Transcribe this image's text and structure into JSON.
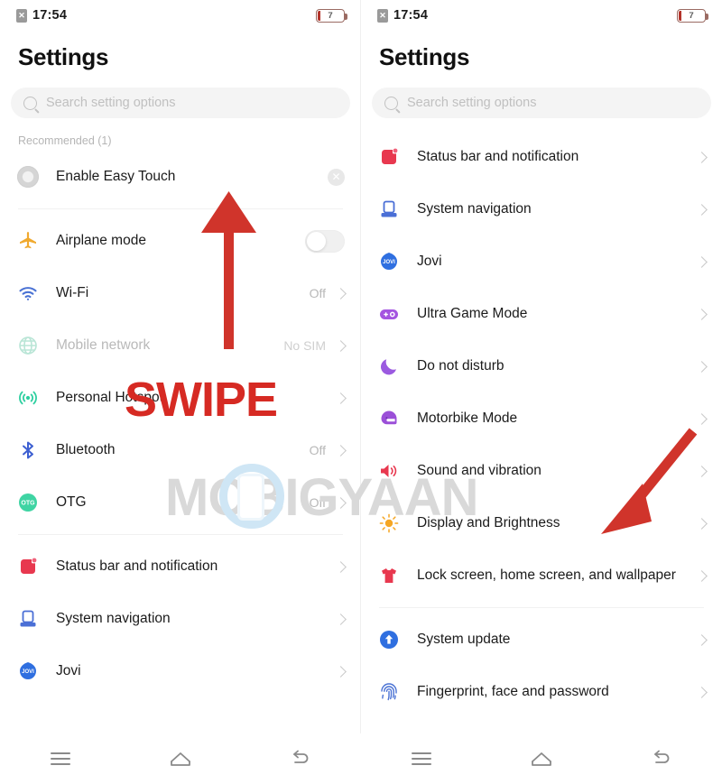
{
  "status_bar": {
    "sim_icon": "no-sim-icon",
    "sim_glyph": "✕",
    "time": "17:54",
    "battery_level": "7"
  },
  "header": {
    "title": "Settings"
  },
  "search": {
    "icon": "search-icon",
    "placeholder": "Search setting options",
    "value": ""
  },
  "left_screen": {
    "recommended_label": "Recommended (1)",
    "recommended_item": {
      "icon": "easy-touch-icon",
      "label": "Enable Easy Touch",
      "close_glyph": "✕"
    },
    "items": [
      {
        "icon": "airplane-icon",
        "label": "Airplane mode",
        "value": "",
        "control": "toggle",
        "toggle_on": false,
        "dim": false
      },
      {
        "icon": "wifi-icon",
        "label": "Wi-Fi",
        "value": "Off",
        "control": "chevron",
        "dim": false
      },
      {
        "icon": "globe-icon",
        "label": "Mobile network",
        "value": "No SIM",
        "control": "chevron",
        "dim": true
      },
      {
        "icon": "hotspot-icon",
        "label": "Personal Hotspot",
        "value": "",
        "control": "chevron",
        "dim": false
      },
      {
        "icon": "bluetooth-icon",
        "label": "Bluetooth",
        "value": "Off",
        "control": "chevron",
        "dim": false
      },
      {
        "icon": "otg-icon",
        "label": "OTG",
        "value": "Off",
        "control": "chevron",
        "dim": false
      }
    ],
    "items_group2": [
      {
        "icon": "status-bar-icon",
        "label": "Status bar and notification",
        "value": "",
        "control": "chevron",
        "dim": false
      },
      {
        "icon": "system-navigation-icon",
        "label": "System navigation",
        "value": "",
        "control": "chevron",
        "dim": false
      },
      {
        "icon": "jovi-icon",
        "label": "Jovi",
        "value": "",
        "control": "chevron",
        "dim": false
      }
    ]
  },
  "right_screen": {
    "items": [
      {
        "icon": "status-bar-icon",
        "label": "Status bar and notification",
        "control": "chevron"
      },
      {
        "icon": "system-navigation-icon",
        "label": "System navigation",
        "control": "chevron"
      },
      {
        "icon": "jovi-icon",
        "label": "Jovi",
        "control": "chevron"
      },
      {
        "icon": "ultra-game-mode-icon",
        "label": "Ultra Game Mode",
        "control": "chevron"
      },
      {
        "icon": "moon-icon",
        "label": "Do not disturb",
        "control": "chevron"
      },
      {
        "icon": "motorbike-icon",
        "label": "Motorbike Mode",
        "control": "chevron"
      },
      {
        "icon": "speaker-icon",
        "label": "Sound and vibration",
        "control": "chevron"
      },
      {
        "icon": "sun-icon",
        "label": "Display and Brightness",
        "control": "chevron"
      },
      {
        "icon": "tshirt-icon",
        "label": "Lock screen, home screen, and wallpaper",
        "control": "chevron"
      }
    ],
    "items_group2": [
      {
        "icon": "system-update-icon",
        "label": "System update",
        "control": "chevron"
      },
      {
        "icon": "fingerprint-icon",
        "label": "Fingerprint, face and password",
        "control": "chevron"
      }
    ]
  },
  "navbar": {
    "menu_label": "menu-icon",
    "home_label": "home-icon",
    "back_label": "back-icon"
  },
  "annotations": {
    "swipe_text": "SWIPE",
    "arrow_color": "#d0342b",
    "up_arrow": "swipe-up-arrow",
    "pointer_arrow": "display-brightness-pointer-arrow"
  },
  "watermark": {
    "text_before": "M",
    "text_after": "BIGYAAN",
    "full_text": "MOBIGYAAN",
    "color": "#d9d9d9",
    "accent": "#cfe6f5"
  }
}
